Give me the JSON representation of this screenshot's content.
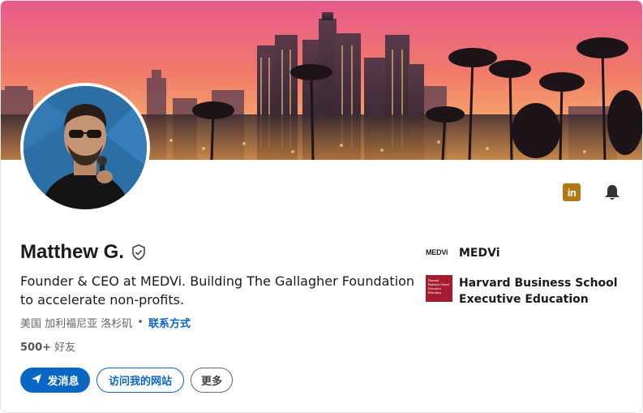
{
  "profile": {
    "name": "Matthew G.",
    "headline": "Founder & CEO at MEDVi. Building The Gallagher Foundation to accelerate non-profits.",
    "location": "美国 加利福尼亚 洛杉矶",
    "contact_link": "联系方式",
    "connections_count": "500+",
    "connections_label": "好友"
  },
  "actions": {
    "message": "发消息",
    "visit_website": "访问我的网站",
    "more": "更多"
  },
  "experience": [
    {
      "logo_text": "MEDVi",
      "name": "MEDVi"
    },
    {
      "logo_text": "Harvard Business School Executive Education",
      "name": "Harvard Business School Executive Education"
    }
  ],
  "icons": {
    "linkedin": "linkedin-icon",
    "bell": "bell-icon",
    "verified": "verified-shield-icon",
    "send": "send-icon"
  },
  "colors": {
    "primary": "#0a66c2",
    "linkedin_badge": "#b07a16",
    "hbs_red": "#a51c30"
  }
}
